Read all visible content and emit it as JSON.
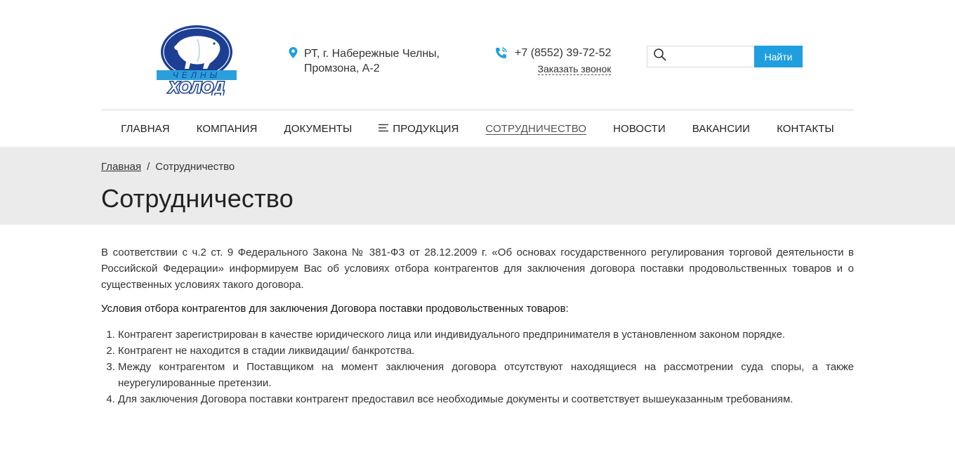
{
  "header": {
    "logo_text_top": "ЧЕЛНЫ",
    "logo_text_bottom": "ХОЛОД",
    "address_line1": "РТ, г. Набережные Челны,",
    "address_line2": "Промзона, А-2",
    "phone": "+7 (8552) 39-72-52",
    "callback_label": "Заказать звонок",
    "search_placeholder": "",
    "search_button": "Найти"
  },
  "nav": {
    "items": [
      {
        "label": "Главная"
      },
      {
        "label": "Компания"
      },
      {
        "label": "Документы"
      },
      {
        "label": "Продукция"
      },
      {
        "label": "Сотрудничество"
      },
      {
        "label": "Новости"
      },
      {
        "label": "Вакансии"
      },
      {
        "label": "Контакты"
      }
    ]
  },
  "breadcrumb": {
    "home": "Главная",
    "separator": "/",
    "current": "Сотрудничество"
  },
  "page": {
    "title": "Сотрудничество",
    "intro": "В соответствии с ч.2 ст. 9 Федерального Закона № 381-ФЗ от 28.12.2009 г. «Об основах государственного регулирования торговой деятельности в Российской Федерации» информируем Вас об условиях отбора контрагентов для заключения договора поставки продовольственных товаров и о существенных условиях такого договора.",
    "subhead": "Условия отбора контрагентов для заключения Договора поставки продовольственных товаров:",
    "conditions": [
      "Контрагент зарегистрирован в качестве юридического лица или индивидуального предпринимателя в установленном законом порядке.",
      "Контрагент не находится в стадии ликвидации/ банкротства.",
      "Между контрагентом и Поставщиком на момент заключения договора отсутствуют находящиеся на рассмотрении суда споры, а также неурегулированные претензии.",
      "Для заключения Договора поставки контрагент предоставил все необходимые документы и соответствует вышеуказанным требованиям."
    ]
  },
  "colors": {
    "accent": "#1f9fdf",
    "logo_blue": "#1c3f94",
    "band": "#ebebeb"
  }
}
